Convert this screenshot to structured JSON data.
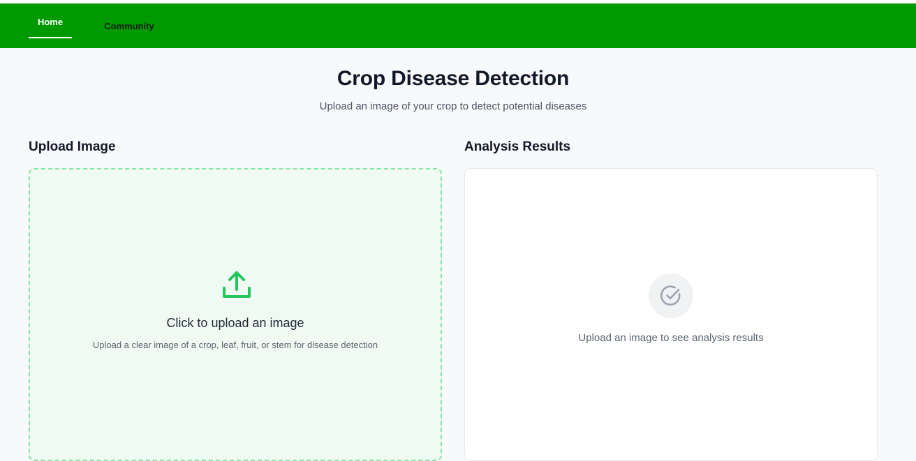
{
  "nav": {
    "items": [
      {
        "label": "Home",
        "active": true
      },
      {
        "label": "Community",
        "active": false
      }
    ]
  },
  "header": {
    "title": "Crop Disease Detection",
    "subtitle": "Upload an image of your crop to detect potential diseases"
  },
  "upload": {
    "heading": "Upload Image",
    "title": "Click to upload an image",
    "hint": "Upload a clear image of a crop, leaf, fruit, or stem for disease detection",
    "icon": "upload-icon"
  },
  "results": {
    "heading": "Analysis Results",
    "empty_text": "Upload an image to see analysis results",
    "icon": "check-circle-icon"
  },
  "colors": {
    "navbar": "#009a00",
    "accent_green": "#22c55e",
    "upload_bg": "#effbf2",
    "upload_border": "#86e3a4"
  }
}
